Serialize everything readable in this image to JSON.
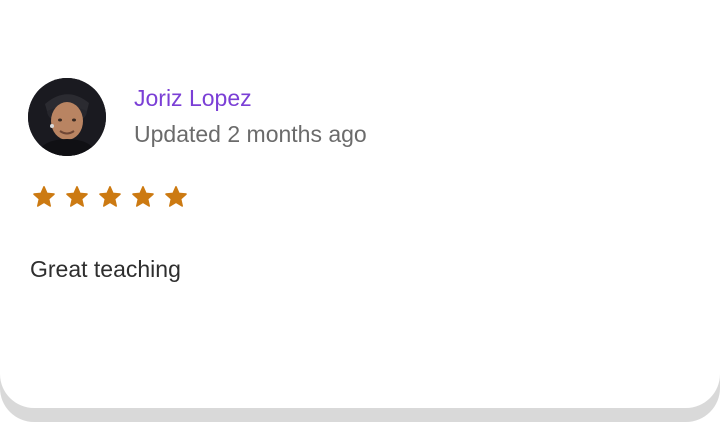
{
  "review": {
    "author": "Joriz Lopez",
    "updated": "Updated 2 months ago",
    "rating": 5,
    "rating_max": 5,
    "text": "Great teaching",
    "star_color": "#cc7a12",
    "author_color": "#7b3fd6",
    "avatar_icon": "user-photo-avatar"
  }
}
